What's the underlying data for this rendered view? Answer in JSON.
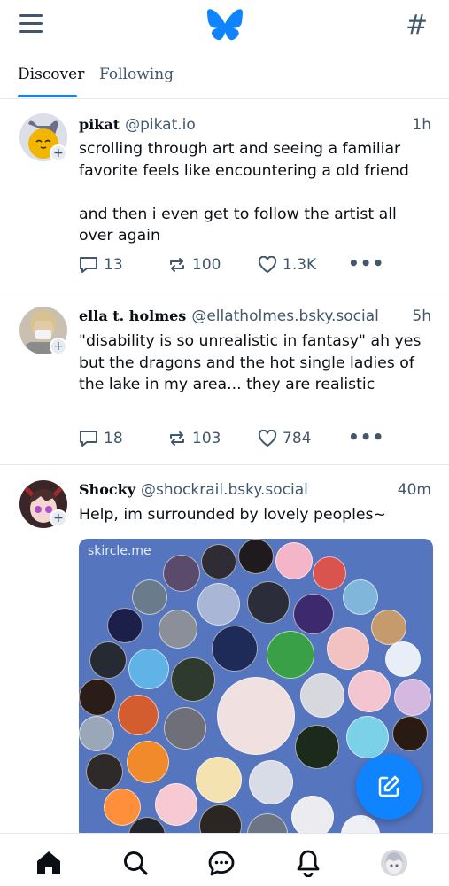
{
  "header": {
    "menu_icon": "hamburger-menu-icon",
    "logo_icon": "butterfly-logo-icon",
    "hashtag_icon": "#",
    "brand_color": "#1083fe"
  },
  "tabs": [
    {
      "label": "Discover",
      "active": true
    },
    {
      "label": "Following",
      "active": false
    }
  ],
  "posts": [
    {
      "display_name": "pikat",
      "handle": "@pikat.io",
      "time": "1h",
      "text": "scrolling through art and seeing a familiar favorite feels like encountering a old friend\n\nand then i even get to follow the artist all over again",
      "replies": "13",
      "reposts": "100",
      "likes": "1.3K",
      "follow_badge": "+"
    },
    {
      "display_name": "ella t. holmes",
      "handle": "@ellatholmes.bsky.social",
      "time": "5h",
      "text": "\"disability is so unrealistic in fantasy\" ah yes but the dragons and the hot single ladies of the lake in my area... they are realistic",
      "replies": "18",
      "reposts": "103",
      "likes": "784",
      "follow_badge": "+"
    },
    {
      "display_name": "Shocky",
      "handle": "@shockrail.bsky.social",
      "time": "40m",
      "text": "Help, im surrounded by lovely peoples~",
      "embed_label": "skircle.me",
      "follow_badge": "+"
    }
  ],
  "actions": {
    "more_label": "•••"
  },
  "bottom_nav": [
    {
      "name": "home",
      "icon": "home-icon"
    },
    {
      "name": "search",
      "icon": "search-icon"
    },
    {
      "name": "chat",
      "icon": "chat-icon"
    },
    {
      "name": "notifications",
      "icon": "bell-icon"
    },
    {
      "name": "profile",
      "icon": "avatar"
    }
  ]
}
